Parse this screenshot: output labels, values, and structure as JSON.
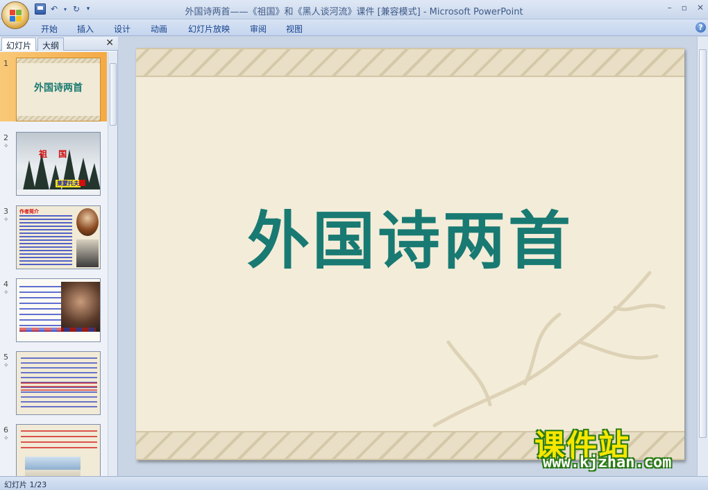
{
  "window": {
    "title": "外国诗两首——《祖国》和《黑人谈河流》课件 [兼容模式] - Microsoft PowerPoint"
  },
  "ribbon": {
    "tabs": [
      {
        "label": "开始"
      },
      {
        "label": "插入"
      },
      {
        "label": "设计"
      },
      {
        "label": "动画"
      },
      {
        "label": "幻灯片放映"
      },
      {
        "label": "审阅"
      },
      {
        "label": "视图"
      }
    ]
  },
  "left_panel": {
    "tabs": [
      {
        "label": "幻灯片",
        "active": true
      },
      {
        "label": "大纲",
        "active": false
      }
    ],
    "slides": [
      {
        "number": "1",
        "selected": true,
        "title": "外国诗两首"
      },
      {
        "number": "2",
        "title": "祖 国",
        "author": "莱蒙托夫"
      },
      {
        "number": "3",
        "title": "作者简介"
      },
      {
        "number": "4"
      },
      {
        "number": "5"
      },
      {
        "number": "6"
      }
    ]
  },
  "slide": {
    "title": "外国诗两首"
  },
  "watermark": {
    "cn": "课件站",
    "url": "www.kjzhan.com"
  },
  "status": {
    "slide_counter": "幻灯片 1/23"
  },
  "colors": {
    "title_teal": "#187a72",
    "selected_thumb": "#f4a944"
  }
}
